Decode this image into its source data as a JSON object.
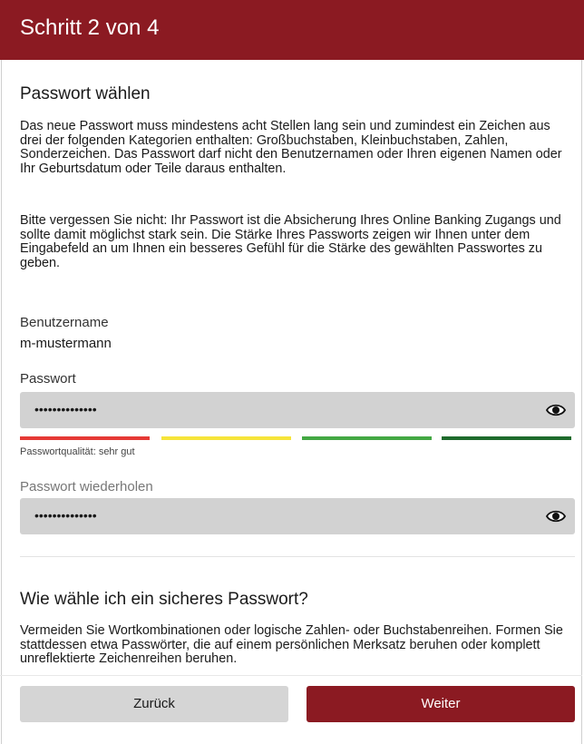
{
  "header": {
    "title": "Schritt 2 von 4"
  },
  "intro": {
    "title": "Passwort wählen",
    "paragraph1": "Das neue Passwort muss mindestens acht Stellen lang sein und zumindest ein Zeichen aus drei der folgenden Kategorien enthalten: Großbuchstaben, Kleinbuchstaben, Zahlen, Sonderzeichen. Das Passwort darf nicht den Benutzernamen oder Ihren eigenen Namen oder Ihr Geburtsdatum oder Teile daraus enthalten.",
    "paragraph2": "Bitte vergessen Sie nicht: Ihr Passwort ist die Absicherung Ihres Online Banking Zugangs und sollte damit möglichst stark sein. Die Stärke Ihres Passworts zeigen wir Ihnen unter dem Eingabefeld an um Ihnen ein besseres Gefühl für die Stärke des gewählten Passwortes zu geben."
  },
  "username": {
    "label": "Benutzername",
    "value": "m-mustermann"
  },
  "password": {
    "label": "Passwort",
    "masked_value": "••••••••••••••",
    "strength_colors": [
      "#e53935",
      "#f6e43a",
      "#43a843",
      "#1e6b2c"
    ],
    "strength_level": 4,
    "quality_text": "Passwortqualität: sehr gut"
  },
  "password_repeat": {
    "label": "Passwort wiederholen",
    "masked_value": "••••••••••••••"
  },
  "tips": {
    "title": "Wie wähle ich ein sicheres Passwort?",
    "paragraph": "Vermeiden Sie Wortkombinationen oder logische Zahlen- oder Buchstabenreihen. Formen Sie stattdessen etwa Passwörter, die auf einem persönlichen Merksatz beruhen oder komplett unreflektierte Zeichenreihen beruhen."
  },
  "buttons": {
    "back": "Zurück",
    "next": "Weiter"
  },
  "colors": {
    "brand": "#8b1a22",
    "field": "#d2d2d2"
  }
}
